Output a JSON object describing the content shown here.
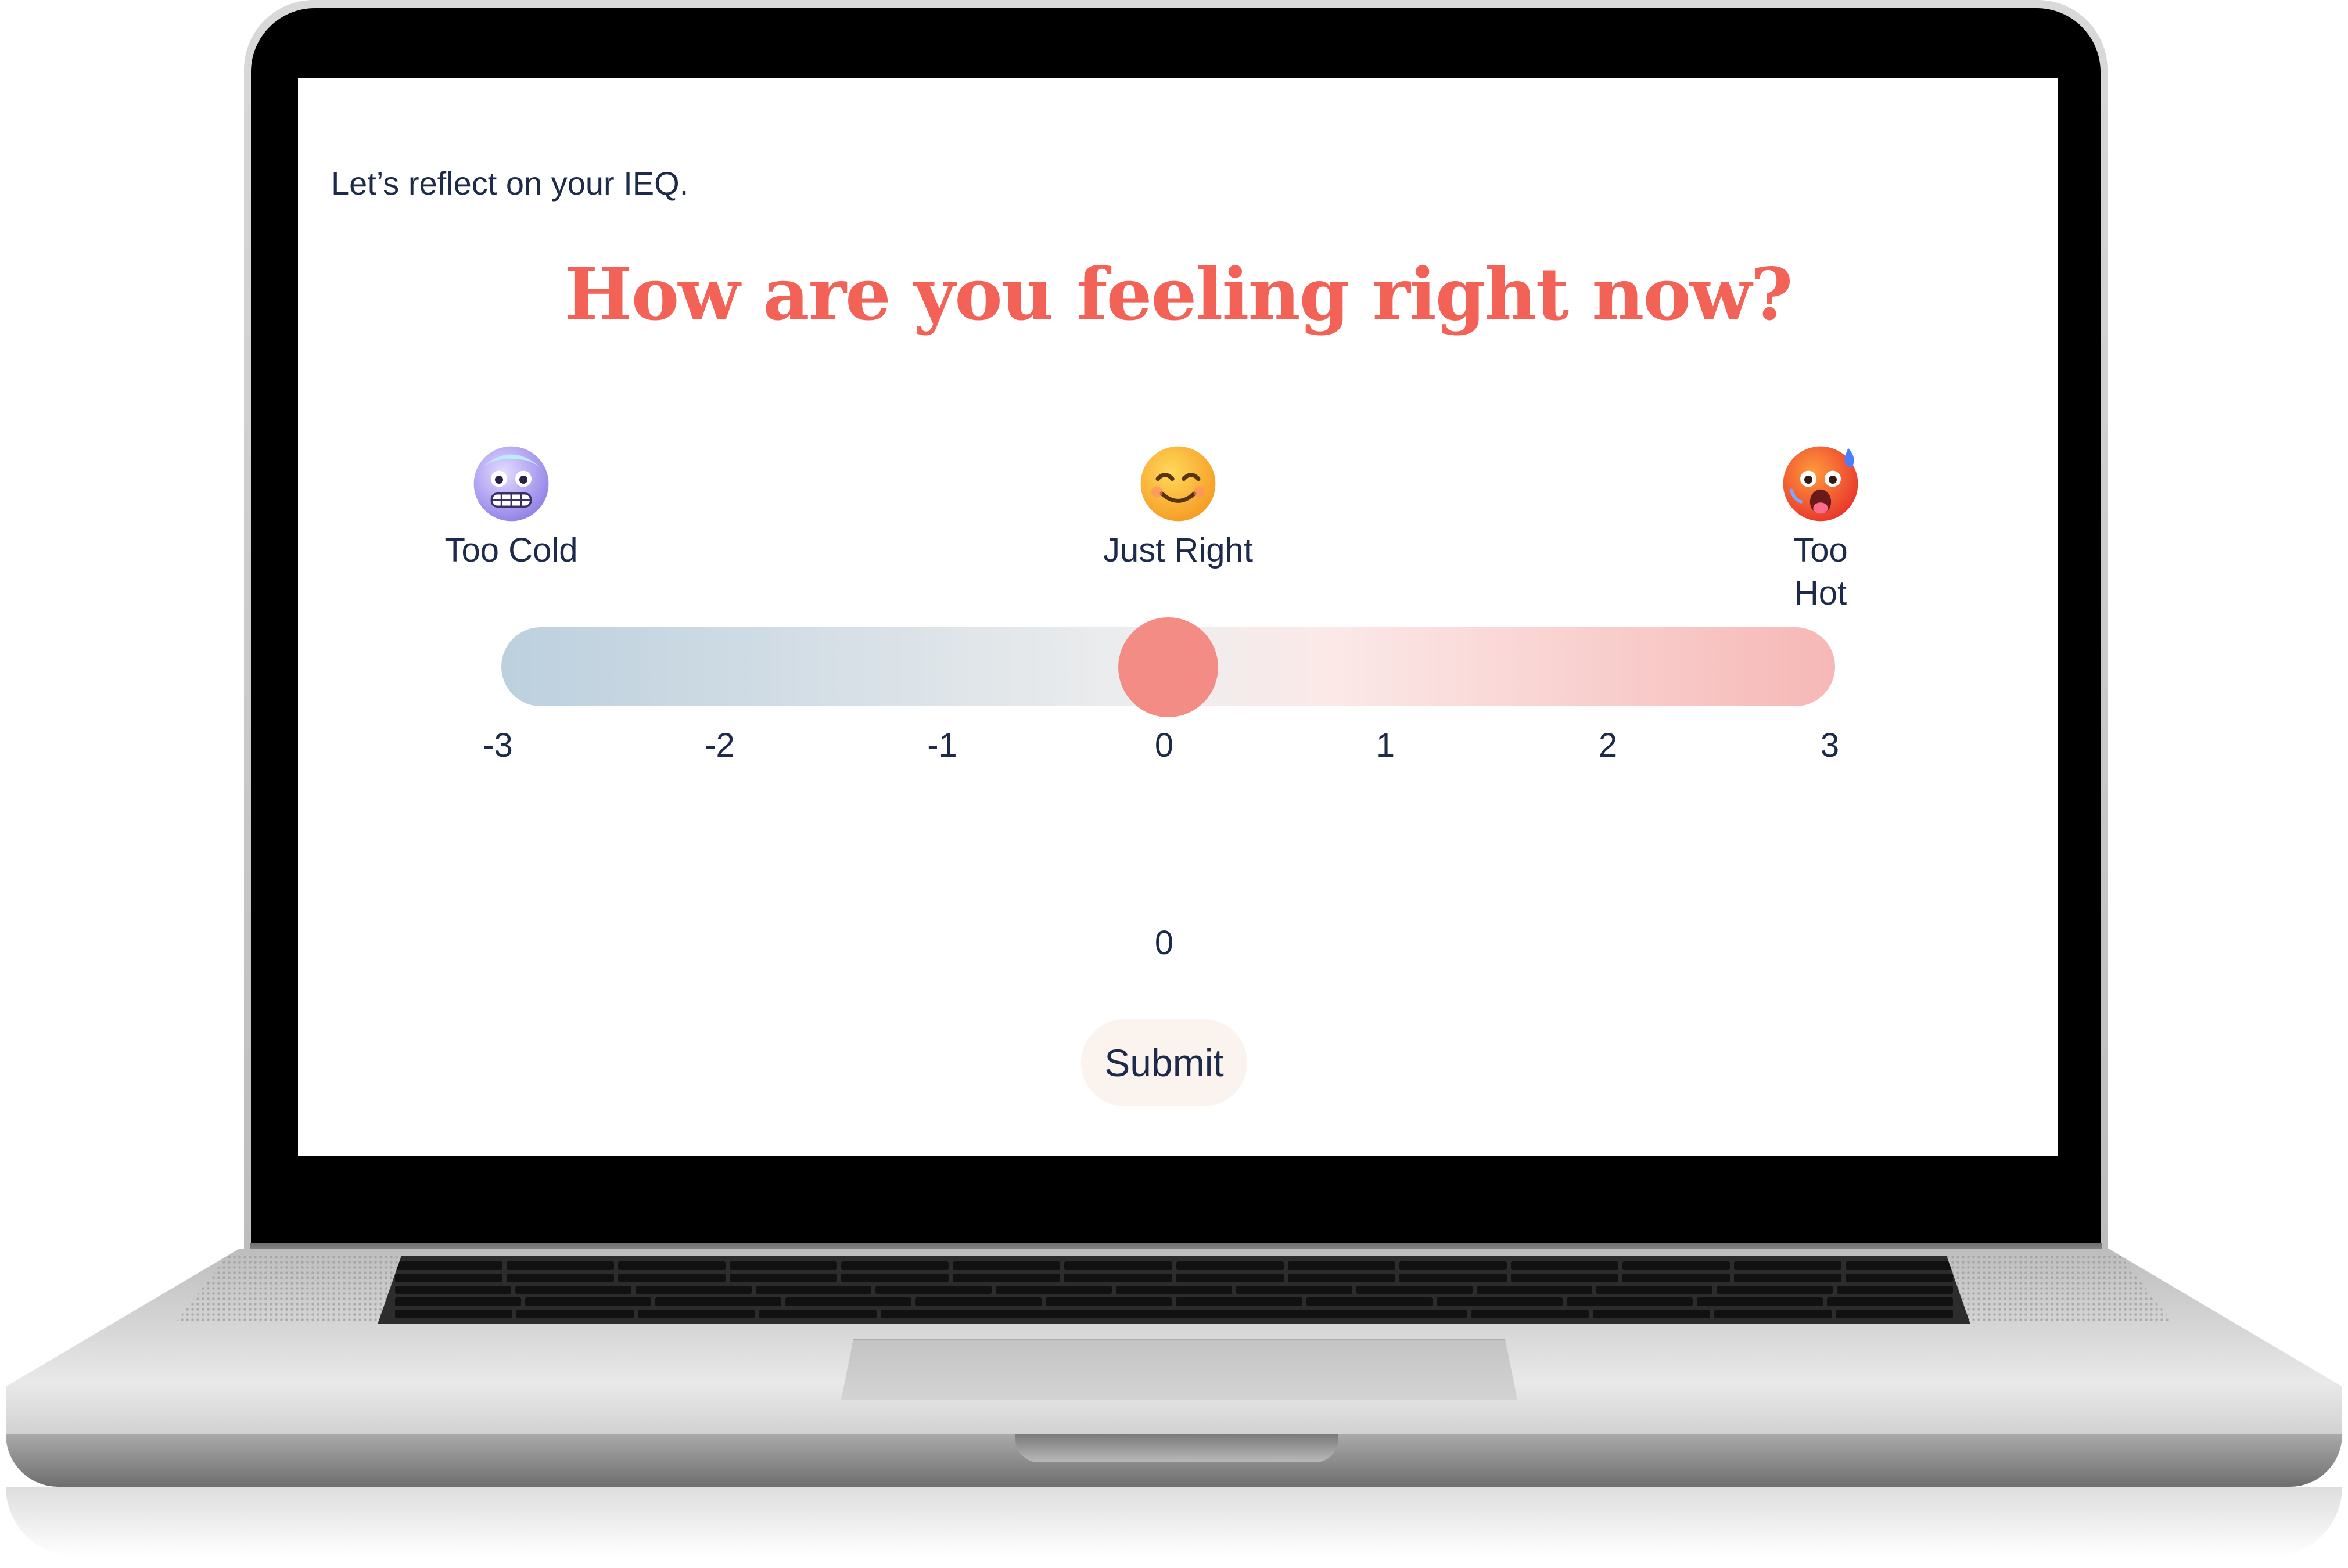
{
  "survey": {
    "intro": "Let’s reflect on your IEQ.",
    "question": "How are you feeling right now?"
  },
  "scale": {
    "anchors": [
      {
        "label": "Too Cold",
        "icon": "cold-face-icon"
      },
      {
        "label": "Just Right",
        "icon": "smiling-face-icon"
      },
      {
        "label_lines": [
          "Too",
          "Hot"
        ],
        "icon": "hot-face-icon"
      }
    ],
    "ticks": [
      "-3",
      "-2",
      "-1",
      "0",
      "1",
      "2",
      "3"
    ],
    "min": -3,
    "max": 3,
    "value": 0,
    "value_display": "0",
    "colors": {
      "cold": "#bcd0de",
      "neutral": "#eeeeee",
      "hot": "#f6b8b6",
      "thumb": "#f48c86"
    }
  },
  "actions": {
    "submit_label": "Submit"
  },
  "theme": {
    "heading_color": "#f26257",
    "text_color": "#1d2a4a"
  }
}
